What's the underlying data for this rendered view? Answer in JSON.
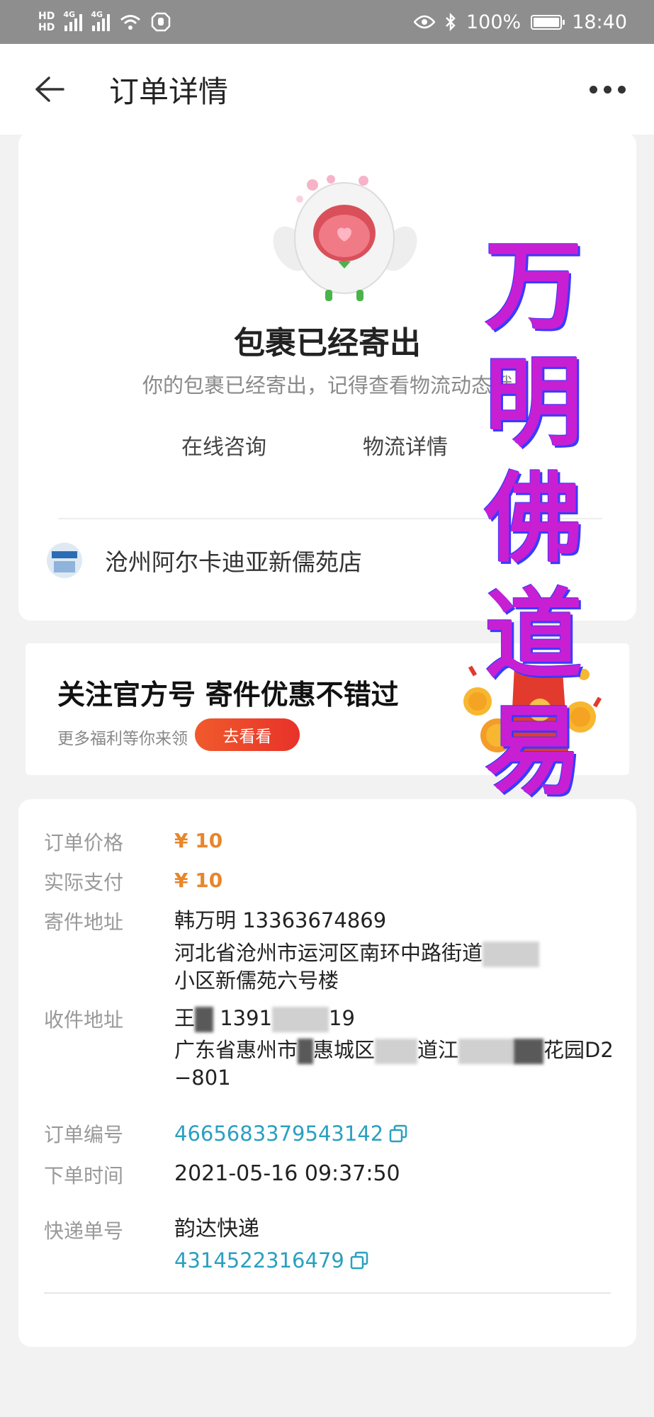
{
  "status_bar": {
    "hd_top": "HD",
    "hd_bottom": "HD",
    "net1": "4G",
    "net2": "4G",
    "battery": "100%",
    "time": "18:40"
  },
  "header": {
    "title": "订单详情"
  },
  "status_card": {
    "title": "包裹已经寄出",
    "subtitle": "你的包裹已经寄出，记得查看物流动态哦",
    "consult_label": "在线咨询",
    "logistics_label": "物流详情",
    "store_name": "沧州阿尔卡迪亚新儒苑店"
  },
  "promo": {
    "title": "关注官方号 寄件优惠不错过",
    "subtitle": "更多福利等你来领",
    "button_label": "去看看"
  },
  "order_info": {
    "price_label": "订单价格",
    "price_value": "¥ 10",
    "paid_label": "实际支付",
    "paid_value": "¥ 10",
    "sender_label": "寄件地址",
    "sender_line1": "韩万明 13363674869",
    "sender_line2": "河北省沧州市运河区南环中路街道",
    "sender_line3": "小区新儒苑六号楼",
    "receiver_label": "收件地址",
    "receiver_line1_a": "王",
    "receiver_line1_b": "1391",
    "receiver_line1_c": "19",
    "receiver_line2_a": "广东省惠州市",
    "receiver_line2_b": "惠城区",
    "receiver_line2_c": "道江",
    "receiver_line2_d": "花园D2",
    "receiver_line3": "−801",
    "order_no_label": "订单编号",
    "order_no_value": "4665683379543142",
    "order_time_label": "下单时间",
    "order_time_value": "2021-05-16 09:37:50",
    "express_label": "快递单号",
    "express_company": "韵达快递",
    "express_no": "4314522316479"
  },
  "watermark": {
    "chars": [
      "万",
      "明",
      "佛",
      "道",
      "易"
    ]
  },
  "colors": {
    "accent_price": "#e8862a",
    "link": "#2aa0c0",
    "promo_button": "#e8322a",
    "watermark": "#c81fd3"
  }
}
